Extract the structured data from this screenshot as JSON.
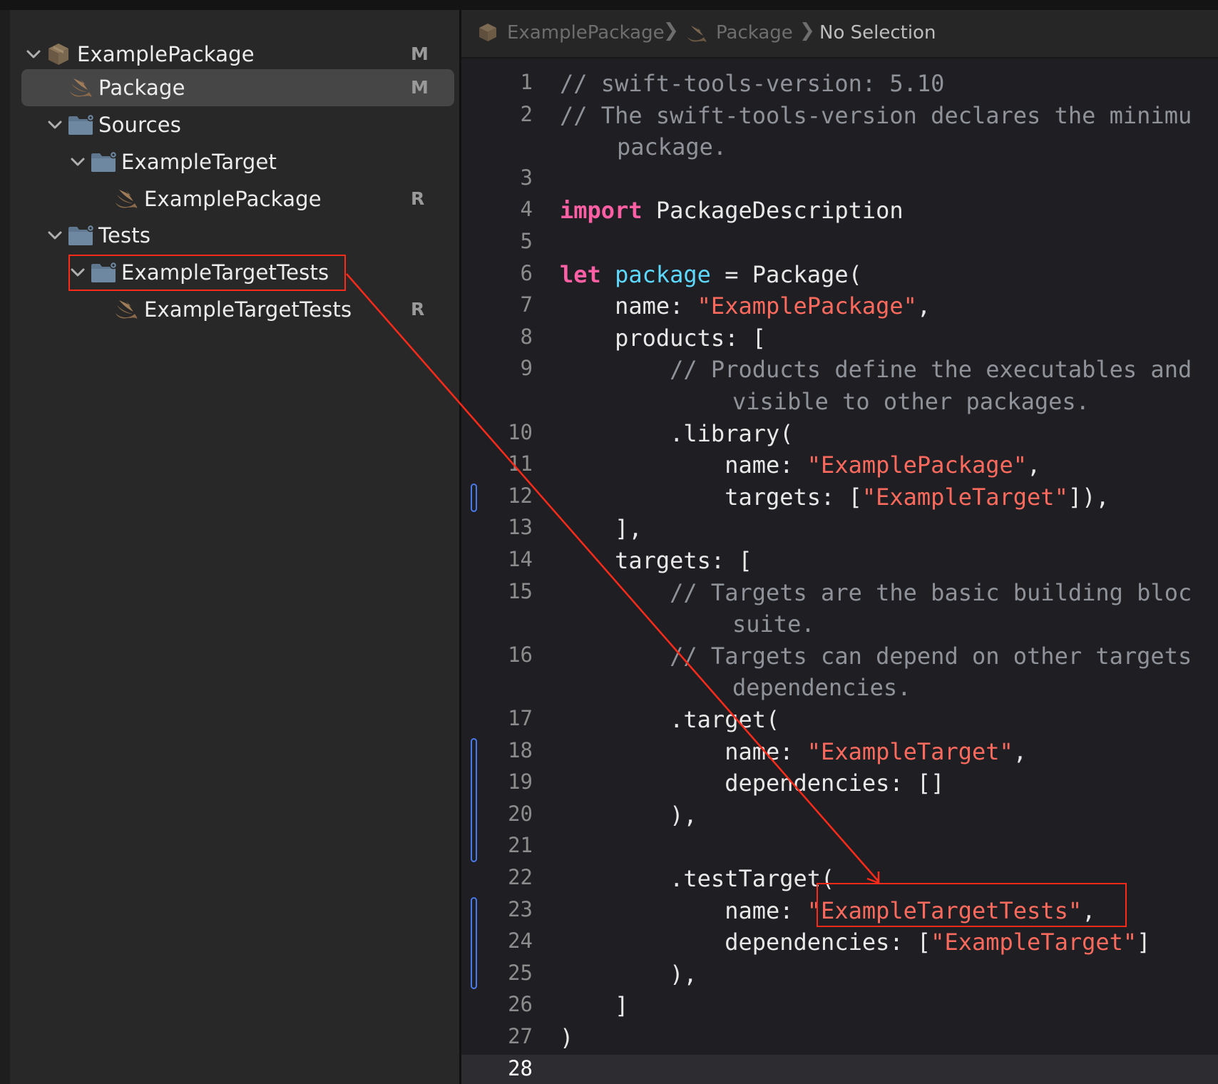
{
  "navigator": {
    "items": [
      {
        "label": "ExamplePackage",
        "badge": "M",
        "icon": "package-icon",
        "chevron": "chevron-down-icon"
      },
      {
        "label": "Package",
        "badge": "M",
        "icon": "swift-file-icon",
        "selected": true
      },
      {
        "label": "Sources",
        "badge": "",
        "icon": "folder-icon",
        "chevron": "chevron-down-icon"
      },
      {
        "label": "ExampleTarget",
        "badge": "",
        "icon": "folder-icon",
        "chevron": "chevron-down-icon"
      },
      {
        "label": "ExamplePackage",
        "badge": "R",
        "icon": "swift-file-icon"
      },
      {
        "label": "Tests",
        "badge": "",
        "icon": "folder-icon",
        "chevron": "chevron-down-icon"
      },
      {
        "label": "ExampleTargetTests",
        "badge": "",
        "icon": "folder-icon",
        "chevron": "chevron-down-icon"
      },
      {
        "label": "ExampleTargetTests",
        "badge": "R",
        "icon": "swift-file-icon"
      }
    ]
  },
  "jumpbar": {
    "crumbs": [
      "ExamplePackage",
      "Package",
      "No Selection"
    ],
    "separator": "❯"
  },
  "editor": {
    "current_line": "28",
    "lines": [
      {
        "n": "1",
        "parts": [
          {
            "c": "cm",
            "t": "// swift-tools-version: 5.10"
          }
        ]
      },
      {
        "n": "2",
        "parts": [
          {
            "c": "cm",
            "t": "// The swift-tools-version declares the minimu"
          }
        ]
      },
      {
        "n": "",
        "wrap": true,
        "parts": [
          {
            "c": "cm",
            "t": "package."
          }
        ]
      },
      {
        "n": "3",
        "parts": []
      },
      {
        "n": "4",
        "parts": [
          {
            "c": "kw",
            "t": "import"
          },
          {
            "c": "plain",
            "t": " PackageDescription"
          }
        ]
      },
      {
        "n": "5",
        "parts": []
      },
      {
        "n": "6",
        "parts": [
          {
            "c": "kw",
            "t": "let"
          },
          {
            "c": "plain",
            "t": " "
          },
          {
            "c": "dec",
            "t": "package"
          },
          {
            "c": "plain",
            "t": " = Package("
          }
        ]
      },
      {
        "n": "7",
        "parts": [
          {
            "c": "plain",
            "t": "    name: "
          },
          {
            "c": "str",
            "t": "\"ExamplePackage\""
          },
          {
            "c": "plain",
            "t": ","
          }
        ]
      },
      {
        "n": "8",
        "parts": [
          {
            "c": "plain",
            "t": "    products: ["
          }
        ]
      },
      {
        "n": "9",
        "parts": [
          {
            "c": "cm",
            "t": "        // Products define the executables and"
          }
        ]
      },
      {
        "n": "",
        "wrap2": true,
        "parts": [
          {
            "c": "cm",
            "t": "visible to other packages."
          }
        ]
      },
      {
        "n": "10",
        "parts": [
          {
            "c": "plain",
            "t": "        .library("
          }
        ]
      },
      {
        "n": "11",
        "parts": [
          {
            "c": "plain",
            "t": "            name: "
          },
          {
            "c": "str",
            "t": "\"ExamplePackage\""
          },
          {
            "c": "plain",
            "t": ","
          }
        ]
      },
      {
        "n": "12",
        "parts": [
          {
            "c": "plain",
            "t": "            targets: ["
          },
          {
            "c": "str",
            "t": "\"ExampleTarget\""
          },
          {
            "c": "plain",
            "t": "]),"
          }
        ]
      },
      {
        "n": "13",
        "parts": [
          {
            "c": "plain",
            "t": "    ],"
          }
        ]
      },
      {
        "n": "14",
        "parts": [
          {
            "c": "plain",
            "t": "    targets: ["
          }
        ]
      },
      {
        "n": "15",
        "parts": [
          {
            "c": "cm",
            "t": "        // Targets are the basic building bloc"
          }
        ]
      },
      {
        "n": "",
        "wrap2": true,
        "parts": [
          {
            "c": "cm",
            "t": "suite."
          }
        ]
      },
      {
        "n": "16",
        "parts": [
          {
            "c": "cm",
            "t": "        // Targets can depend on other targets"
          }
        ]
      },
      {
        "n": "",
        "wrap2": true,
        "parts": [
          {
            "c": "cm",
            "t": "dependencies."
          }
        ]
      },
      {
        "n": "17",
        "parts": [
          {
            "c": "plain",
            "t": "        .target("
          }
        ]
      },
      {
        "n": "18",
        "parts": [
          {
            "c": "plain",
            "t": "            name: "
          },
          {
            "c": "str",
            "t": "\"ExampleTarget\""
          },
          {
            "c": "plain",
            "t": ","
          }
        ]
      },
      {
        "n": "19",
        "parts": [
          {
            "c": "plain",
            "t": "            dependencies: []"
          }
        ]
      },
      {
        "n": "20",
        "parts": [
          {
            "c": "plain",
            "t": "        ),"
          }
        ]
      },
      {
        "n": "21",
        "parts": []
      },
      {
        "n": "22",
        "parts": [
          {
            "c": "plain",
            "t": "        .testTarget("
          }
        ]
      },
      {
        "n": "23",
        "parts": [
          {
            "c": "plain",
            "t": "            name: "
          },
          {
            "c": "str",
            "t": "\"ExampleTargetTests\""
          },
          {
            "c": "plain",
            "t": ","
          }
        ]
      },
      {
        "n": "24",
        "parts": [
          {
            "c": "plain",
            "t": "            dependencies: ["
          },
          {
            "c": "str",
            "t": "\"ExampleTarget\""
          },
          {
            "c": "plain",
            "t": "]"
          }
        ]
      },
      {
        "n": "25",
        "parts": [
          {
            "c": "plain",
            "t": "        ),"
          }
        ]
      },
      {
        "n": "26",
        "parts": [
          {
            "c": "plain",
            "t": "    ]"
          }
        ]
      },
      {
        "n": "27",
        "parts": [
          {
            "c": "plain",
            "t": ")"
          }
        ]
      },
      {
        "n": "28",
        "parts": []
      }
    ]
  },
  "colors": {
    "annotation": "#ff2a1a",
    "change_bar": "#4a79ec",
    "keyword": "#fc5fa3",
    "string": "#fc6a5d",
    "declaration": "#5dd8ff",
    "comment": "#8f9299"
  }
}
